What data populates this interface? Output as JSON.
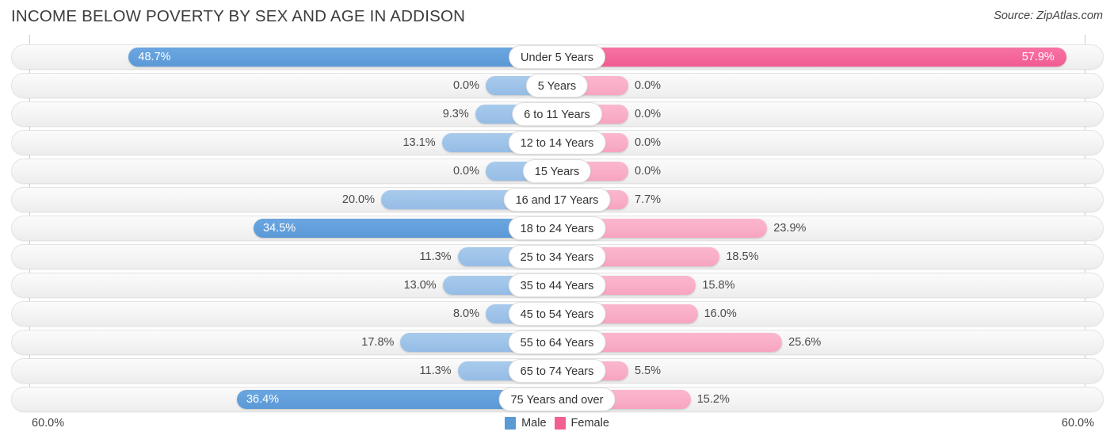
{
  "header": {
    "title": "INCOME BELOW POVERTY BY SEX AND AGE IN ADDISON",
    "source": "Source: ZipAtlas.com"
  },
  "legend": {
    "male_label": "Male",
    "female_label": "Female",
    "male_color": "#5b9bd5",
    "female_color": "#f25f93"
  },
  "axis": {
    "left_tick": "60.0%",
    "right_tick": "60.0%",
    "max": 60.0
  },
  "chart_data": {
    "type": "bar",
    "title": "INCOME BELOW POVERTY BY SEX AND AGE IN ADDISON",
    "subtitle": "Source: ZipAtlas.com",
    "orientation": "horizontal-diverging",
    "xlabel": "",
    "ylabel": "",
    "xlim": [
      -60.0,
      60.0
    ],
    "grid": false,
    "legend_position": "bottom-center",
    "categories": [
      "Under 5 Years",
      "5 Years",
      "6 to 11 Years",
      "12 to 14 Years",
      "15 Years",
      "16 and 17 Years",
      "18 to 24 Years",
      "25 to 34 Years",
      "35 to 44 Years",
      "45 to 54 Years",
      "55 to 64 Years",
      "65 to 74 Years",
      "75 Years and over"
    ],
    "series": [
      {
        "name": "Male",
        "color": "#5b9bd5",
        "values": [
          48.7,
          0.0,
          9.3,
          13.1,
          0.0,
          20.0,
          34.5,
          11.3,
          13.0,
          8.0,
          17.8,
          11.3,
          36.4
        ],
        "labels": [
          "48.7%",
          "0.0%",
          "9.3%",
          "13.1%",
          "0.0%",
          "20.0%",
          "34.5%",
          "11.3%",
          "13.0%",
          "8.0%",
          "17.8%",
          "11.3%",
          "36.4%"
        ]
      },
      {
        "name": "Female",
        "color": "#f25f93",
        "values": [
          57.9,
          0.0,
          0.0,
          0.0,
          0.0,
          7.7,
          23.9,
          18.5,
          15.8,
          16.0,
          25.6,
          5.5,
          15.2
        ],
        "labels": [
          "57.9%",
          "0.0%",
          "0.0%",
          "0.0%",
          "0.0%",
          "7.7%",
          "23.9%",
          "18.5%",
          "15.8%",
          "16.0%",
          "25.6%",
          "5.5%",
          "15.2%"
        ]
      }
    ]
  },
  "rows": [
    {
      "label": "Under 5 Years",
      "male": "48.7%",
      "female": "57.9%"
    },
    {
      "label": "5 Years",
      "male": "0.0%",
      "female": "0.0%"
    },
    {
      "label": "6 to 11 Years",
      "male": "9.3%",
      "female": "0.0%"
    },
    {
      "label": "12 to 14 Years",
      "male": "13.1%",
      "female": "0.0%"
    },
    {
      "label": "15 Years",
      "male": "0.0%",
      "female": "0.0%"
    },
    {
      "label": "16 and 17 Years",
      "male": "20.0%",
      "female": "7.7%"
    },
    {
      "label": "18 to 24 Years",
      "male": "34.5%",
      "female": "23.9%"
    },
    {
      "label": "25 to 34 Years",
      "male": "11.3%",
      "female": "18.5%"
    },
    {
      "label": "35 to 44 Years",
      "male": "13.0%",
      "female": "15.8%"
    },
    {
      "label": "45 to 54 Years",
      "male": "8.0%",
      "female": "16.0%"
    },
    {
      "label": "55 to 64 Years",
      "male": "17.8%",
      "female": "25.6%"
    },
    {
      "label": "65 to 74 Years",
      "male": "11.3%",
      "female": "5.5%"
    },
    {
      "label": "75 Years and over",
      "male": "36.4%",
      "female": "15.2%"
    }
  ]
}
